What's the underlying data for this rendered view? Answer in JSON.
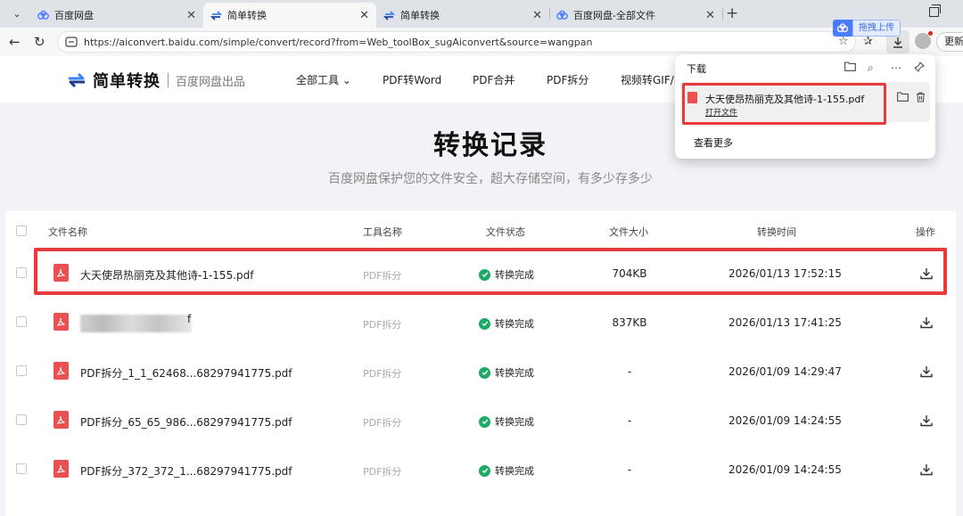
{
  "browser": {
    "tabs": [
      {
        "title": "百度网盘",
        "active": false
      },
      {
        "title": "简单转换",
        "active": true
      },
      {
        "title": "简单转换",
        "active": false
      },
      {
        "title": "百度网盘-全部文件",
        "active": false
      }
    ],
    "url": "https://aiconvert.baidu.com/simple/convert/record?from=Web_toolBox_sugAiconvert&source=wangpan",
    "upload_badge": "拖拽上传",
    "update_label": "更新"
  },
  "download_panel": {
    "title": "下载",
    "item": {
      "filename": "大天使昂热丽克及其他诗-1-155.pdf",
      "open_label": "打开文件"
    },
    "more_label": "查看更多"
  },
  "site": {
    "brand_name": "简单转换",
    "brand_sub": "百度网盘出品",
    "nav": [
      "全部工具",
      "PDF转Word",
      "PDF合并",
      "PDF拆分",
      "视频转GIF/M"
    ]
  },
  "hero": {
    "title": "转换记录",
    "subtitle": "百度网盘保护您的文件安全，超大存储空间，有多少存多少"
  },
  "table": {
    "headers": {
      "name": "文件名称",
      "tool": "工具名称",
      "status": "文件状态",
      "size": "文件大小",
      "time": "转换时间",
      "action": "操作"
    },
    "rows": [
      {
        "name": "大天使昂热丽克及其他诗-1-155.pdf",
        "tool": "PDF拆分",
        "status": "转换完成",
        "size": "704KB",
        "time": "2026/01/13 17:52:15",
        "blurred": false
      },
      {
        "name": "f",
        "tool": "PDF拆分",
        "status": "转换完成",
        "size": "837KB",
        "time": "2026/01/13 17:41:25",
        "blurred": true
      },
      {
        "name": "PDF拆分_1_1_62468...68297941775.pdf",
        "tool": "PDF拆分",
        "status": "转换完成",
        "size": "-",
        "time": "2026/01/09 14:29:47",
        "blurred": false
      },
      {
        "name": "PDF拆分_65_65_986...68297941775.pdf",
        "tool": "PDF拆分",
        "status": "转换完成",
        "size": "-",
        "time": "2026/01/09 14:24:55",
        "blurred": false
      },
      {
        "name": "PDF拆分_372_372_1...68297941775.pdf",
        "tool": "PDF拆分",
        "status": "转换完成",
        "size": "-",
        "time": "2026/01/09 14:24:55",
        "blurred": false
      }
    ]
  },
  "colors": {
    "highlight": "#e8393c",
    "success": "#1fa866",
    "pdf_red": "#e9504f",
    "baidu_blue": "#4b7bff"
  }
}
